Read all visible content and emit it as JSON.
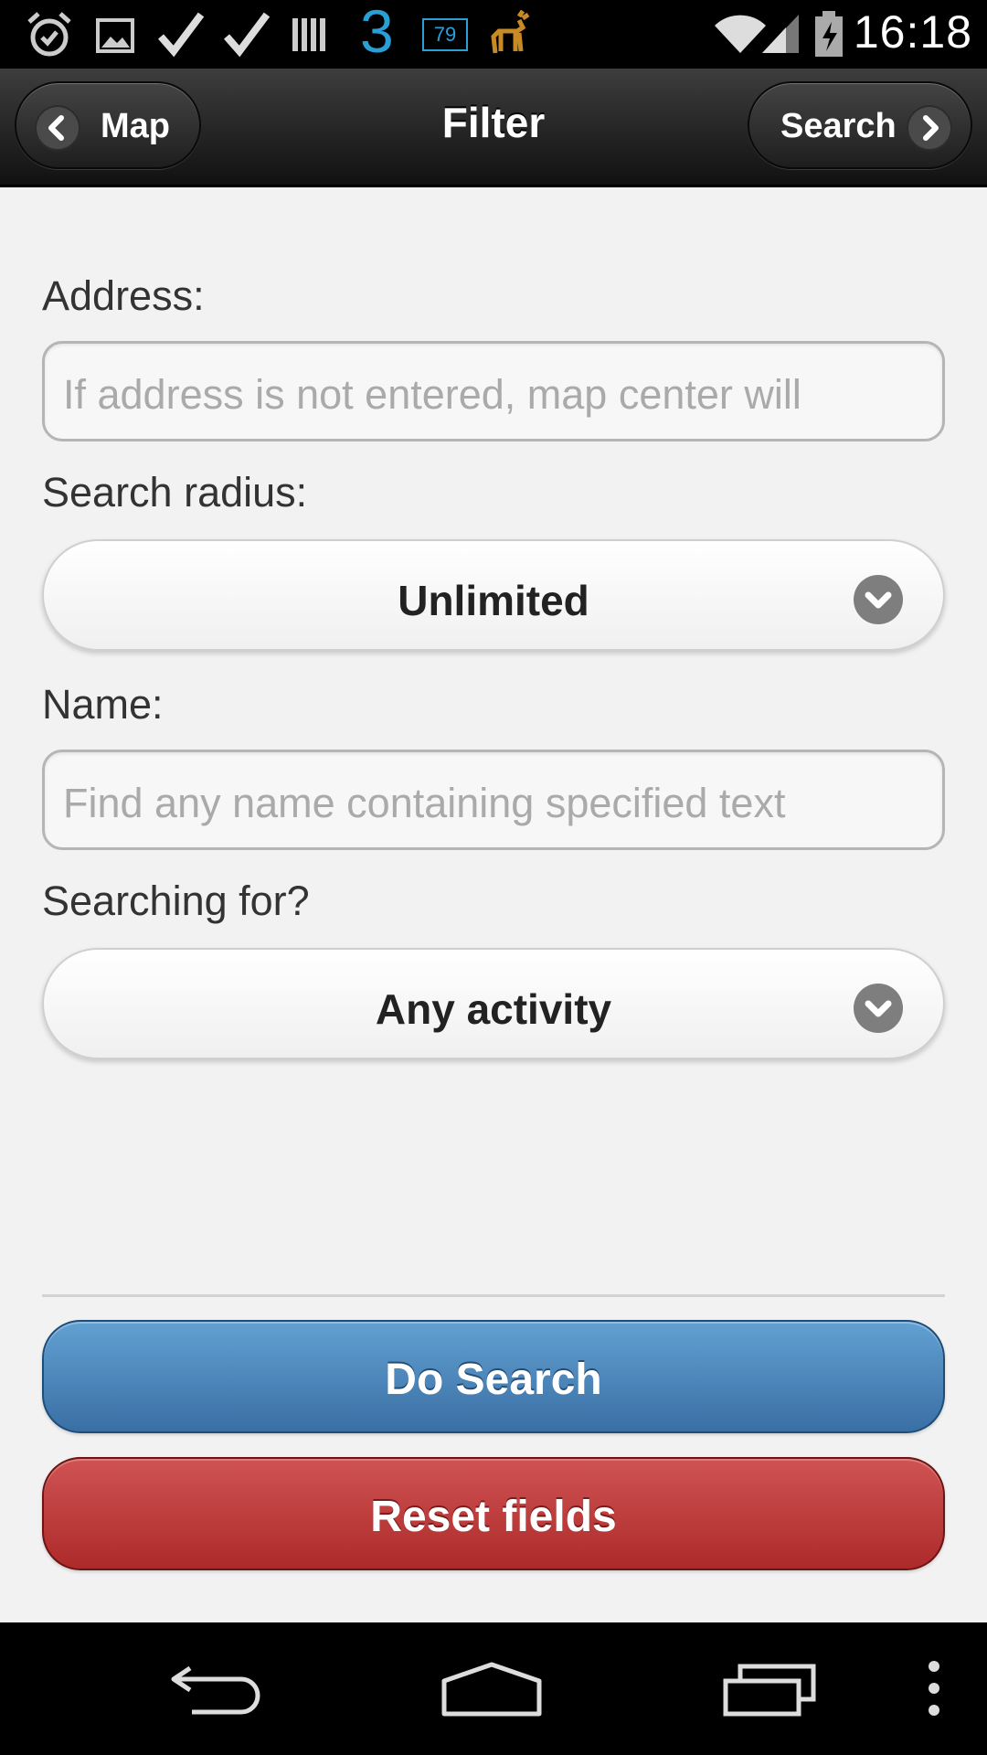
{
  "status_bar": {
    "time": "16:18",
    "carrier_digit": "3",
    "battery_badge": "79",
    "icons": [
      "alarm-icon",
      "image-icon",
      "check-icon",
      "check-icon",
      "barcode-icon",
      "carrier-3-icon",
      "battery-badge-icon",
      "deer-icon",
      "wifi-icon",
      "signal-icon",
      "battery-charging-icon"
    ]
  },
  "header": {
    "title": "Filter",
    "back_label": "Map",
    "forward_label": "Search"
  },
  "form": {
    "address_label": "Address:",
    "address_placeholder": "If address is not entered, map center will",
    "radius_label": "Search radius:",
    "radius_value": "Unlimited",
    "name_label": "Name:",
    "name_placeholder": "Find any name containing specified text",
    "searching_label": "Searching for?",
    "searching_value": "Any activity"
  },
  "actions": {
    "do_search_label": "Do Search",
    "reset_label": "Reset fields"
  },
  "nav_bar": {
    "icons": [
      "back-icon",
      "home-icon",
      "recent-apps-icon",
      "overflow-menu-icon"
    ]
  },
  "colors": {
    "primary_button": "#4a86bd",
    "danger_button": "#bd3b3b",
    "header_bg": "#1e1e1e"
  }
}
